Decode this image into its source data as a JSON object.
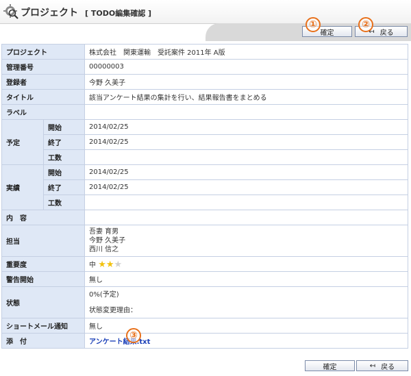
{
  "header": {
    "title": "プロジェクト",
    "subtitle": "[ TODO編集確認 ]"
  },
  "toolbar": {
    "confirm_label": "確定",
    "back_label": "戻る"
  },
  "callouts": [
    "①",
    "②",
    "③"
  ],
  "rows": {
    "project": {
      "label": "プロジェクト",
      "value": "株式会社　関東運輸　受託案件 2011年 A版"
    },
    "manage_no": {
      "label": "管理番号",
      "value": "00000003"
    },
    "registrant": {
      "label": "登録者",
      "value": "今野 久美子"
    },
    "title": {
      "label": "タイトル",
      "value": "該当アンケート結果の集計を行い、結果報告書をまとめる"
    },
    "label_row": {
      "label": "ラベル",
      "value": ""
    },
    "plan": {
      "label": "予定",
      "start_label": "開始",
      "start": "2014/02/25",
      "end_label": "終了",
      "end": "2014/02/25",
      "effort_label": "工数",
      "effort": ""
    },
    "actual": {
      "label": "実績",
      "start_label": "開始",
      "start": "2014/02/25",
      "end_label": "終了",
      "end": "2014/02/25",
      "effort_label": "工数",
      "effort": ""
    },
    "content": {
      "label": "内　容",
      "value": ""
    },
    "assignee": {
      "label": "担当",
      "people": [
        "吾妻 育男",
        "今野 久美子",
        "西川 信之"
      ]
    },
    "priority": {
      "label": "重要度",
      "value": "中",
      "stars_filled": 2,
      "stars_total": 3
    },
    "alert": {
      "label": "警告開始",
      "value": "無し"
    },
    "status": {
      "label": "状態",
      "value": "0%(予定)",
      "reason_label": "状態変更理由："
    },
    "shortmail": {
      "label": "ショートメール通知",
      "value": "無し"
    },
    "attachment": {
      "label": "添　付",
      "file": "アンケート結果.txt"
    }
  },
  "colors": {
    "label_bg": "#dfe8f6",
    "border": "#c4cfe3",
    "callout": "#e8701a",
    "star_on": "#f2c20f",
    "link": "#1a3fb8"
  }
}
